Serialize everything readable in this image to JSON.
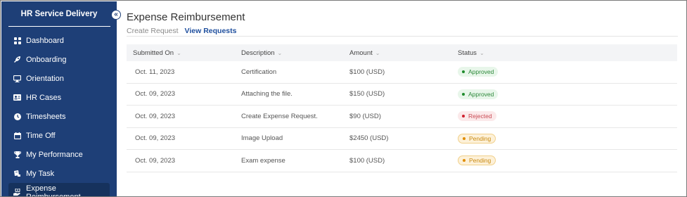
{
  "sidebar": {
    "brand": "HR Service Delivery",
    "collapse_icon": "double-chevron-left-icon",
    "items": [
      {
        "label": "Dashboard",
        "icon": "dashboard-icon"
      },
      {
        "label": "Onboarding",
        "icon": "rocket-icon"
      },
      {
        "label": "Orientation",
        "icon": "monitor-icon"
      },
      {
        "label": "HR Cases",
        "icon": "id-card-icon"
      },
      {
        "label": "Timesheets",
        "icon": "clock-icon"
      },
      {
        "label": "Time Off",
        "icon": "calendar-icon"
      },
      {
        "label": "My Performance",
        "icon": "trophy-icon"
      },
      {
        "label": "My Task",
        "icon": "task-icon"
      },
      {
        "label": "Expense Reimbursement",
        "icon": "hand-money-icon",
        "active": true
      }
    ]
  },
  "main": {
    "title": "Expense Reimbursement",
    "tabs": [
      {
        "label": "Create Request"
      },
      {
        "label": "View Requests",
        "active": true
      }
    ],
    "table": {
      "headers": [
        "Submitted On",
        "Description",
        "Amount",
        "Status"
      ],
      "rows": [
        {
          "date": "Oct. 11, 2023",
          "description": "Certification",
          "amount": "$100 (USD)",
          "status": "Approved"
        },
        {
          "date": "Oct. 09, 2023",
          "description": "Attaching the file.",
          "amount": "$150 (USD)",
          "status": "Approved"
        },
        {
          "date": "Oct. 09, 2023",
          "description": "Create Expense Request.",
          "amount": "$90 (USD)",
          "status": "Rejected"
        },
        {
          "date": "Oct. 09, 2023",
          "description": "Image Upload",
          "amount": "$2450 (USD)",
          "status": "Pending"
        },
        {
          "date": "Oct. 09, 2023",
          "description": "Exam expense",
          "amount": "$100 (USD)",
          "status": "Pending"
        }
      ]
    }
  },
  "colors": {
    "sidebar_bg": "#1e3f77",
    "active_tab": "#1f4f9e",
    "approved": "#1f8b2c",
    "rejected": "#d0202e",
    "pending": "#e08c00"
  }
}
